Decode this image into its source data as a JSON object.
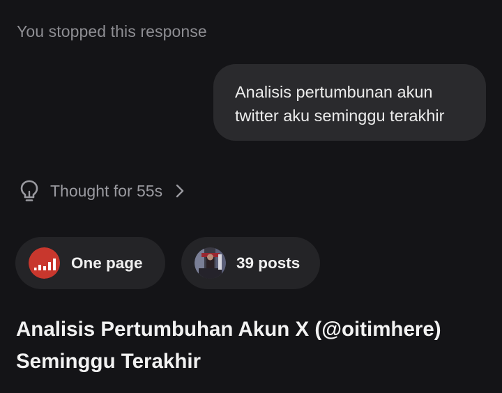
{
  "status": {
    "stopped_text": "You stopped this response"
  },
  "user_message": {
    "text": "Analisis pertumbunan akun twitter aku seminggu terakhir"
  },
  "thinking": {
    "label": "Thought for 55s",
    "icon": "lightbulb-icon",
    "expand_icon": "chevron-right-icon"
  },
  "sources": [
    {
      "label": "One page",
      "icon": "site-favicon-bar-chart-icon",
      "icon_color": "#c8372d"
    },
    {
      "label": "39 posts",
      "icon": "profile-avatar-icon"
    }
  ],
  "response": {
    "heading": "Analisis Pertumbuhan Akun X (@oitimhere) Seminggu Terakhir"
  },
  "colors": {
    "background": "#141417",
    "bubble": "#2a2a2d",
    "chip": "#242427",
    "muted_text": "#8e8e93"
  }
}
